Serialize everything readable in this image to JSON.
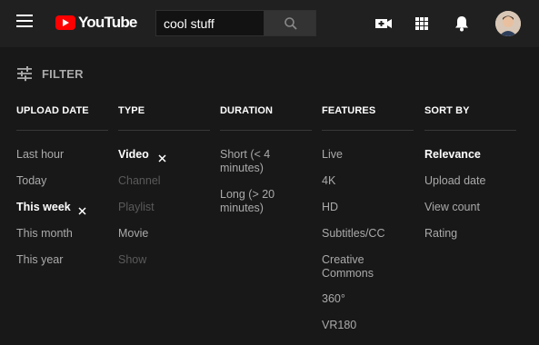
{
  "header": {
    "logo_text": "YouTube",
    "search_value": "cool stuff",
    "icons": [
      "menu-icon",
      "create-video-icon",
      "apps-icon",
      "notifications-icon"
    ]
  },
  "filter_toggle_label": "FILTER",
  "columns": [
    {
      "header": "UPLOAD DATE",
      "options": [
        {
          "label": "Last hour",
          "state": "normal"
        },
        {
          "label": "Today",
          "state": "normal"
        },
        {
          "label": "This week",
          "state": "selected"
        },
        {
          "label": "This month",
          "state": "normal"
        },
        {
          "label": "This year",
          "state": "normal"
        }
      ]
    },
    {
      "header": "TYPE",
      "options": [
        {
          "label": "Video",
          "state": "selected"
        },
        {
          "label": "Channel",
          "state": "disabled"
        },
        {
          "label": "Playlist",
          "state": "disabled"
        },
        {
          "label": "Movie",
          "state": "normal"
        },
        {
          "label": "Show",
          "state": "disabled"
        }
      ]
    },
    {
      "header": "DURATION",
      "options": [
        {
          "label": "Short (< 4 minutes)",
          "state": "normal"
        },
        {
          "label": "Long (> 20 minutes)",
          "state": "normal"
        }
      ]
    },
    {
      "header": "FEATURES",
      "options": [
        {
          "label": "Live",
          "state": "normal"
        },
        {
          "label": "4K",
          "state": "normal"
        },
        {
          "label": "HD",
          "state": "normal"
        },
        {
          "label": "Subtitles/CC",
          "state": "normal"
        },
        {
          "label": "Creative Commons",
          "state": "normal"
        },
        {
          "label": "360°",
          "state": "normal"
        },
        {
          "label": "VR180",
          "state": "normal"
        }
      ]
    },
    {
      "header": "SORT BY",
      "options": [
        {
          "label": "Relevance",
          "state": "selected"
        },
        {
          "label": "Upload date",
          "state": "normal"
        },
        {
          "label": "View count",
          "state": "normal"
        },
        {
          "label": "Rating",
          "state": "normal"
        }
      ]
    }
  ],
  "colors": {
    "background": "#181818",
    "header": "#202020",
    "accent": "#ff0000",
    "selected_text": "#ffffff",
    "normal_text": "#aaaaaa",
    "disabled_text": "#5a5a5a"
  }
}
